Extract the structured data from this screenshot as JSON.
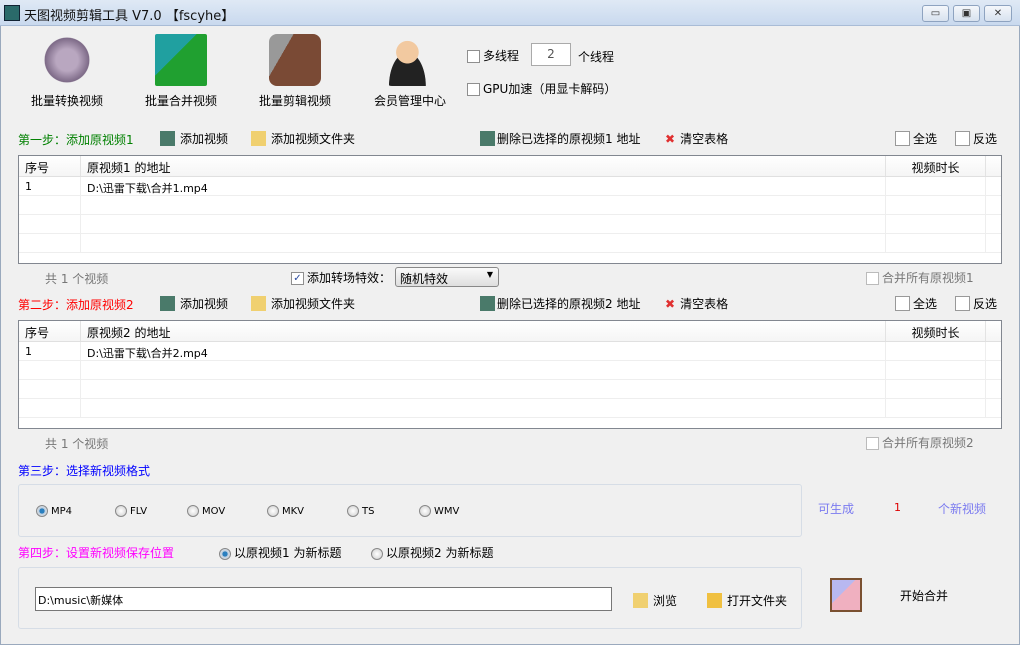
{
  "window": {
    "title": "天图视频剪辑工具 V7.0 【fscyhe】",
    "minimize": "▭",
    "restore": "▣",
    "close": "✕"
  },
  "toolbar": {
    "items": [
      {
        "label": "批量转换视频"
      },
      {
        "label": "批量合并视频"
      },
      {
        "label": "批量剪辑视频"
      },
      {
        "label": "会员管理中心"
      }
    ],
    "multithread_label": "多线程",
    "thread_count": "2",
    "thread_unit": "个线程",
    "gpu_label": "GPU加速（用显卡解码）"
  },
  "step1": {
    "title": "第一步：添加原视频1",
    "add_video": "添加视频",
    "add_folder": "添加视频文件夹",
    "delete_selected": "删除已选择的原视频1 地址",
    "clear": "清空表格",
    "select_all": "全选",
    "invert": "反选",
    "columns": [
      "序号",
      "原视频1 的地址",
      "视频时长"
    ],
    "rows": [
      {
        "index": "1",
        "path": "D:\\迅雷下载\\合并1.mp4",
        "duration": ""
      }
    ],
    "count": "共 1 个视频",
    "transition_label": "添加转场特效：",
    "transition_value": "随机特效",
    "merge_all": "合并所有原视频1"
  },
  "step2": {
    "title": "第二步：添加原视频2",
    "add_video": "添加视频",
    "add_folder": "添加视频文件夹",
    "delete_selected": "删除已选择的原视频2 地址",
    "clear": "清空表格",
    "select_all": "全选",
    "invert": "反选",
    "columns": [
      "序号",
      "原视频2 的地址",
      "视频时长"
    ],
    "rows": [
      {
        "index": "1",
        "path": "D:\\迅雷下载\\合并2.mp4",
        "duration": ""
      }
    ],
    "count": "共 1 个视频",
    "merge_all": "合并所有原视频2"
  },
  "step3": {
    "title": "第三步：选择新视频格式",
    "formats": [
      "MP4",
      "FLV",
      "MOV",
      "MKV",
      "TS",
      "WMV"
    ],
    "selected": "MP4",
    "can_generate": "可生成",
    "new_count": "1",
    "new_unit": "个新视频"
  },
  "step4": {
    "title": "第四步：设置新视频保存位置",
    "opt1": "以原视频1 为新标题",
    "opt2": "以原视频2 为新标题",
    "path": "D:\\music\\新媒体",
    "browse": "浏览",
    "open_folder": "打开文件夹",
    "start": "开始合并"
  },
  "colors": {
    "step1": "#008000",
    "step2": "#ff0000",
    "step3": "#0000ff",
    "step4": "#ff00ff"
  }
}
